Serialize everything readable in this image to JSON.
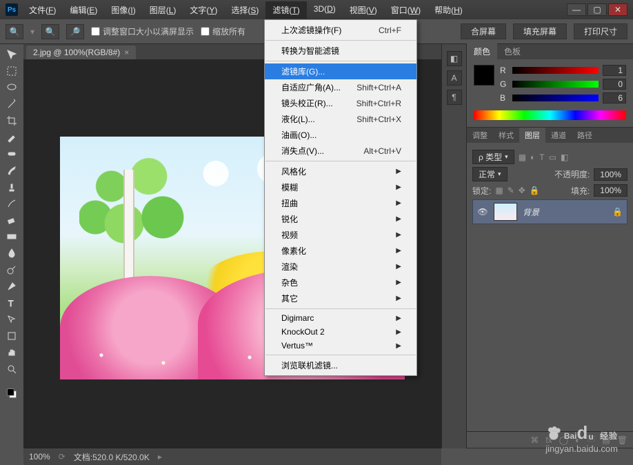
{
  "menubar": {
    "items": [
      {
        "label": "文件(",
        "m": "F",
        "tail": ")"
      },
      {
        "label": "编辑(",
        "m": "E",
        "tail": ")"
      },
      {
        "label": "图像(",
        "m": "I",
        "tail": ")"
      },
      {
        "label": "图层(",
        "m": "L",
        "tail": ")"
      },
      {
        "label": "文字(",
        "m": "Y",
        "tail": ")"
      },
      {
        "label": "选择(",
        "m": "S",
        "tail": ")"
      },
      {
        "label": "滤镜(",
        "m": "T",
        "tail": ")"
      },
      {
        "label": "3D(",
        "m": "D",
        "tail": ")"
      },
      {
        "label": "视图(",
        "m": "V",
        "tail": ")"
      },
      {
        "label": "窗口(",
        "m": "W",
        "tail": ")"
      },
      {
        "label": "帮助(",
        "m": "H",
        "tail": ")"
      }
    ]
  },
  "options": {
    "resize_checkbox": "调整窗口大小以满屏显示",
    "zoom_all_checkbox": "缩放所有",
    "fit_partial": "合屏幕",
    "fill_screen": "填充屏幕",
    "print_size": "打印尺寸"
  },
  "doc_tab": {
    "label": "2.jpg @ 100%(RGB/8#)"
  },
  "status": {
    "zoom": "100%",
    "doc_info": "文档:520.0 K/520.0K"
  },
  "dropdown": {
    "last_filter": "上次滤镜操作(F)",
    "last_filter_sc": "Ctrl+F",
    "smart": "转换为智能滤镜",
    "gallery": "滤镜库(G)...",
    "adaptive": "自适应广角(A)...",
    "adaptive_sc": "Shift+Ctrl+A",
    "lens": "镜头校正(R)...",
    "lens_sc": "Shift+Ctrl+R",
    "liquify": "液化(L)...",
    "liquify_sc": "Shift+Ctrl+X",
    "oil": "油画(O)...",
    "vanish": "消失点(V)...",
    "vanish_sc": "Alt+Ctrl+V",
    "submenus": [
      "风格化",
      "模糊",
      "扭曲",
      "锐化",
      "视频",
      "像素化",
      "渲染",
      "杂色",
      "其它"
    ],
    "plugins": [
      "Digimarc",
      "KnockOut 2",
      "Vertus™"
    ],
    "browse": "浏览联机滤镜..."
  },
  "panels": {
    "color_tab": "颜色",
    "swatches_tab": "色板",
    "rgb": {
      "R": "R",
      "G": "G",
      "B": "B",
      "r": "1",
      "g": "0",
      "b": "6"
    },
    "adjust_tabs": [
      "调整",
      "样式",
      "图层",
      "通道",
      "路径"
    ],
    "filter_label": "ρ 类型",
    "blend": "正常",
    "opacity_label": "不透明度:",
    "opacity_val": "100%",
    "lock_label": "锁定:",
    "fill_label": "填充:",
    "fill_val": "100%",
    "layer_name": "背景"
  },
  "watermark": {
    "brand": "Baidu",
    "brand_cn": "经验",
    "url": "jingyan.baidu.com"
  }
}
